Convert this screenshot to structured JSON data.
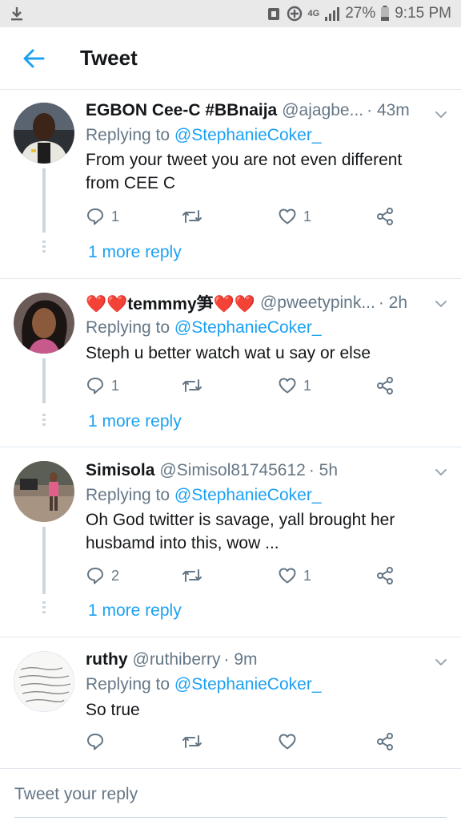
{
  "status_bar": {
    "network": "4G",
    "battery": "27%",
    "time": "9:15 PM"
  },
  "header": {
    "title": "Tweet"
  },
  "tweets": [
    {
      "name": "EGBON Cee-C #BBnaija",
      "handle": "@ajagbe...",
      "time": "· 43m",
      "replying_prefix": "Replying to",
      "replying_to": "@StephanieCoker_",
      "text": "From your tweet you are not even different from CEE C",
      "replies": "1",
      "retweets": "",
      "likes": "1",
      "more_replies": "1 more reply"
    },
    {
      "name": "❤️❤️temmmy笋❤️❤️",
      "handle": "@pweetypink...",
      "time": "· 2h",
      "replying_prefix": "Replying to",
      "replying_to": "@StephanieCoker_",
      "text": "Steph u better watch wat u say or else",
      "replies": "1",
      "retweets": "",
      "likes": "1",
      "more_replies": "1 more reply"
    },
    {
      "name": "Simisola",
      "handle": "@Simisol81745612",
      "time": "· 5h",
      "replying_prefix": "Replying to",
      "replying_to": "@StephanieCoker_",
      "text": "Oh God twitter is savage, yall brought her husbamd into this, wow ...",
      "replies": "2",
      "retweets": "",
      "likes": "1",
      "more_replies": "1 more reply"
    },
    {
      "name": "ruthy",
      "handle": "@ruthiberry",
      "time": "· 9m",
      "replying_prefix": "Replying to",
      "replying_to": "@StephanieCoker_",
      "text": "So true",
      "replies": "",
      "retweets": "",
      "likes": "",
      "avatar_lettering": "we all go well, learning pretty, shes be pretty kind, pretty funny, pretty smart, pretty strong"
    }
  ],
  "reply_bar": {
    "placeholder": "Tweet your reply"
  },
  "colors": {
    "accent": "#1da1f2",
    "muted": "#657786",
    "divider": "#e1e8ed"
  }
}
